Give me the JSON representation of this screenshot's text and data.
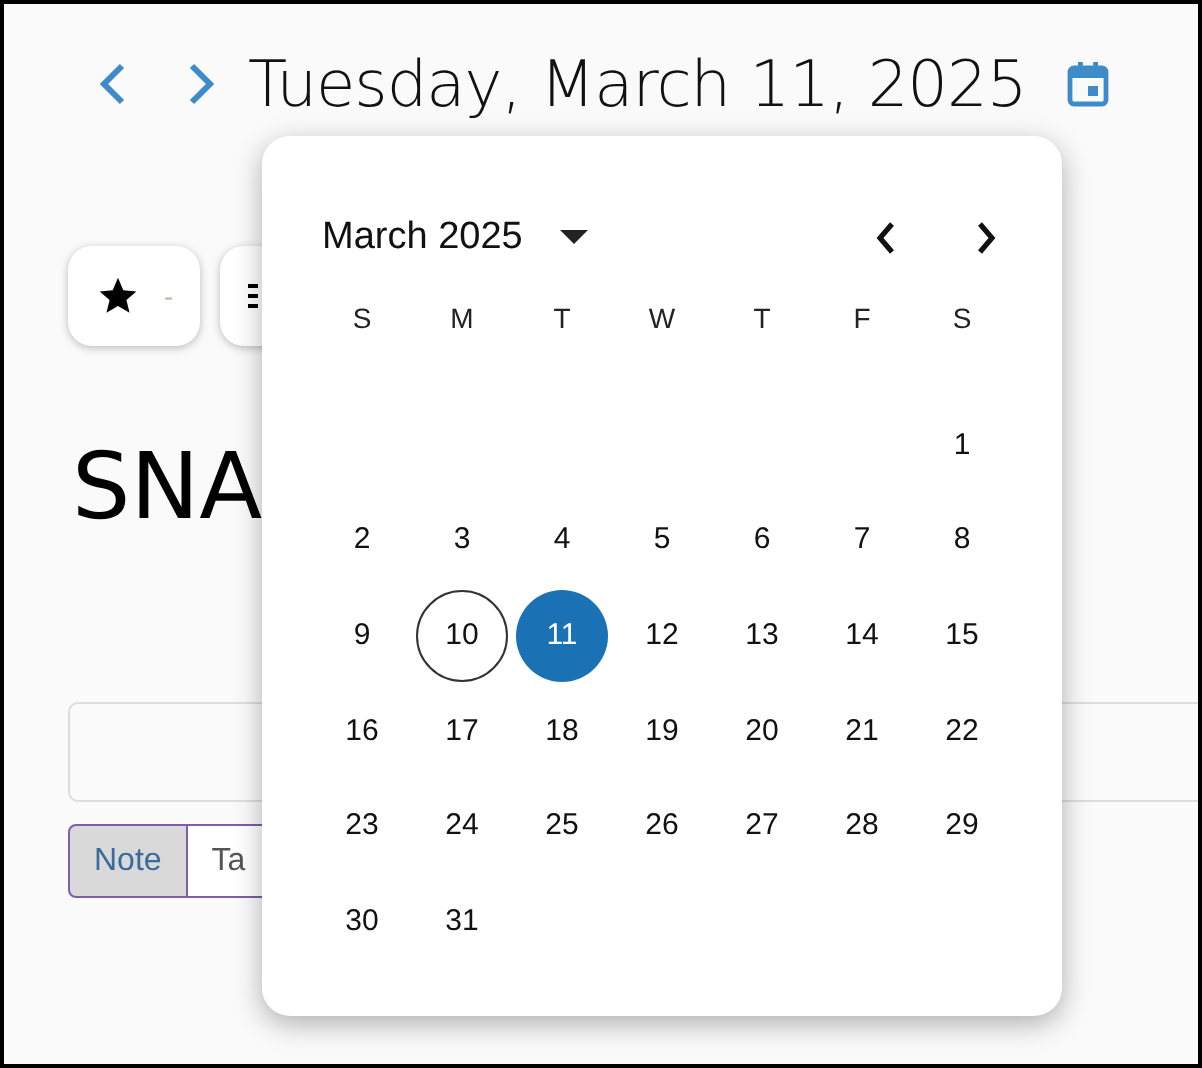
{
  "header": {
    "date": "Tuesday, March 11, 2025"
  },
  "toolbar": {
    "rating_value": "-"
  },
  "title": "SNA",
  "note_types": [
    {
      "label": "Note",
      "selected": true
    },
    {
      "label": "Ta",
      "selected": false
    }
  ],
  "date_picker": {
    "month_label": "March 2025",
    "weekdays": [
      "S",
      "M",
      "T",
      "W",
      "T",
      "F",
      "S"
    ],
    "weeks": [
      {
        "kind": "offset",
        "days": [
          {
            "day": "1",
            "selected": false,
            "today": false
          }
        ]
      },
      {
        "kind": "plain",
        "days": [
          {
            "day": "2",
            "selected": false,
            "today": false
          },
          {
            "day": "3",
            "selected": false,
            "today": false
          },
          {
            "day": "4",
            "selected": false,
            "today": false
          },
          {
            "day": "5",
            "selected": false,
            "today": false
          },
          {
            "day": "6",
            "selected": false,
            "today": false
          },
          {
            "day": "7",
            "selected": false,
            "today": false
          },
          {
            "day": "8",
            "selected": false,
            "today": false
          }
        ]
      },
      {
        "kind": "plain",
        "days": [
          {
            "day": "9",
            "selected": false,
            "today": false
          },
          {
            "day": "10",
            "selected": false,
            "today": true
          },
          {
            "day": "11",
            "selected": true,
            "today": false
          },
          {
            "day": "12",
            "selected": false,
            "today": false
          },
          {
            "day": "13",
            "selected": false,
            "today": false
          },
          {
            "day": "14",
            "selected": false,
            "today": false
          },
          {
            "day": "15",
            "selected": false,
            "today": false
          }
        ]
      },
      {
        "kind": "plain",
        "days": [
          {
            "day": "16",
            "selected": false,
            "today": false
          },
          {
            "day": "17",
            "selected": false,
            "today": false
          },
          {
            "day": "18",
            "selected": false,
            "today": false
          },
          {
            "day": "19",
            "selected": false,
            "today": false
          },
          {
            "day": "20",
            "selected": false,
            "today": false
          },
          {
            "day": "21",
            "selected": false,
            "today": false
          },
          {
            "day": "22",
            "selected": false,
            "today": false
          }
        ]
      },
      {
        "kind": "plain",
        "days": [
          {
            "day": "23",
            "selected": false,
            "today": false
          },
          {
            "day": "24",
            "selected": false,
            "today": false
          },
          {
            "day": "25",
            "selected": false,
            "today": false
          },
          {
            "day": "26",
            "selected": false,
            "today": false
          },
          {
            "day": "27",
            "selected": false,
            "today": false
          },
          {
            "day": "28",
            "selected": false,
            "today": false
          },
          {
            "day": "29",
            "selected": false,
            "today": false
          }
        ]
      },
      {
        "kind": "plain",
        "days": [
          {
            "day": "30",
            "selected": false,
            "today": false
          },
          {
            "day": "31",
            "selected": false,
            "today": false
          }
        ]
      }
    ]
  }
}
